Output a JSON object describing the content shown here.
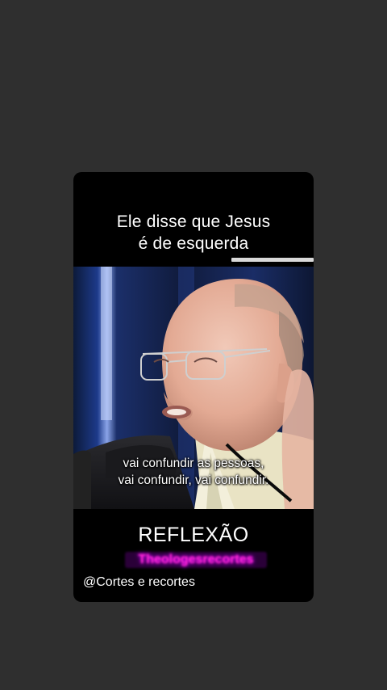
{
  "headline": {
    "line1": "Ele disse que Jesus",
    "line2": "é de esquerda"
  },
  "video": {
    "subtitle_line1": "vai confundir as pessoas,",
    "subtitle_line2": "vai confundir, vai confundir."
  },
  "caption": {
    "title": "REFLEXÃO",
    "blurred_tag": "Theologesrecortes",
    "handle": "@Cortes e recortes"
  },
  "colors": {
    "background": "#2f2f2f",
    "card": "#000000",
    "tag_glow": "#ff2ad4"
  }
}
